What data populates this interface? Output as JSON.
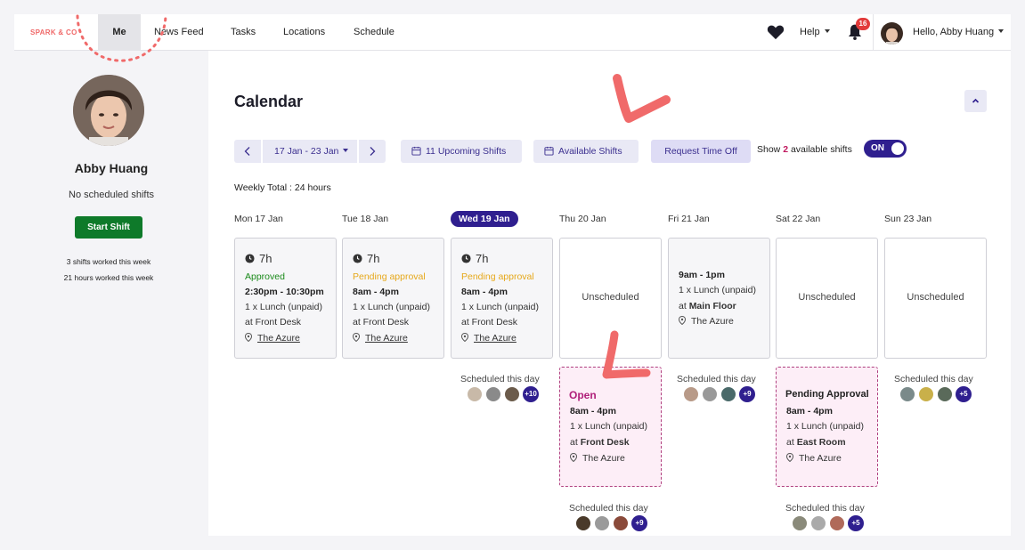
{
  "nav": {
    "logo": "SPARK & CO",
    "items": [
      "Me",
      "News Feed",
      "Tasks",
      "Locations",
      "Schedule"
    ],
    "help": "Help",
    "notifications": "16",
    "greeting": "Hello, Abby Huang"
  },
  "sidebar": {
    "name": "Abby Huang",
    "no_shifts": "No scheduled shifts",
    "start_shift": "Start Shift",
    "shifts_worked": "3 shifts worked this week",
    "hours_worked": "21 hours worked this week"
  },
  "calendar": {
    "title": "Calendar",
    "date_range": "17 Jan - 23 Jan",
    "upcoming_shifts": "11 Upcoming Shifts",
    "available_shifts": "Available Shifts",
    "request_time_off": "Request Time Off",
    "show_prefix": "Show",
    "show_count": "2",
    "show_suffix": "available shifts",
    "toggle": "ON",
    "weekly_total": "Weekly Total : 24 hours",
    "days": [
      "Mon 17 Jan",
      "Tue 18 Jan",
      "Wed 19 Jan",
      "Thu 20 Jan",
      "Fri 21 Jan",
      "Sat 22 Jan",
      "Sun 23 Jan"
    ],
    "shifts": [
      {
        "duration": "7h",
        "status": "Approved",
        "time": "2:30pm - 10:30pm",
        "break": "1 x Lunch (unpaid)",
        "area": "at Front Desk",
        "location": "The Azure"
      },
      {
        "duration": "7h",
        "status": "Pending approval",
        "time": "8am - 4pm",
        "break": "1 x Lunch (unpaid)",
        "area": "at Front Desk",
        "location": "The Azure"
      },
      {
        "duration": "7h",
        "status": "Pending approval",
        "time": "8am - 4pm",
        "break": "1 x Lunch (unpaid)",
        "area": "at Front Desk",
        "location": "The Azure"
      }
    ],
    "unscheduled": "Unscheduled",
    "fri_shift": {
      "time": "9am - 1pm",
      "break": "1 x Lunch (unpaid)",
      "area_prefix": "at",
      "area": "Main Floor",
      "location": "The Azure"
    },
    "open_shift": {
      "title": "Open",
      "time": "8am - 4pm",
      "break": "1 x Lunch (unpaid)",
      "area_prefix": "at",
      "area": "Front Desk",
      "location": "The Azure"
    },
    "pending_shift": {
      "title": "Pending Approval",
      "time": "8am - 4pm",
      "break": "1 x Lunch (unpaid)",
      "area_prefix": "at",
      "area": "East Room",
      "location": "The Azure"
    },
    "scheduled_label": "Scheduled this day",
    "more_wed": "+10",
    "more_fri": "+9",
    "more_sun": "+5",
    "more_thu": "+9",
    "more_sat": "+5"
  }
}
